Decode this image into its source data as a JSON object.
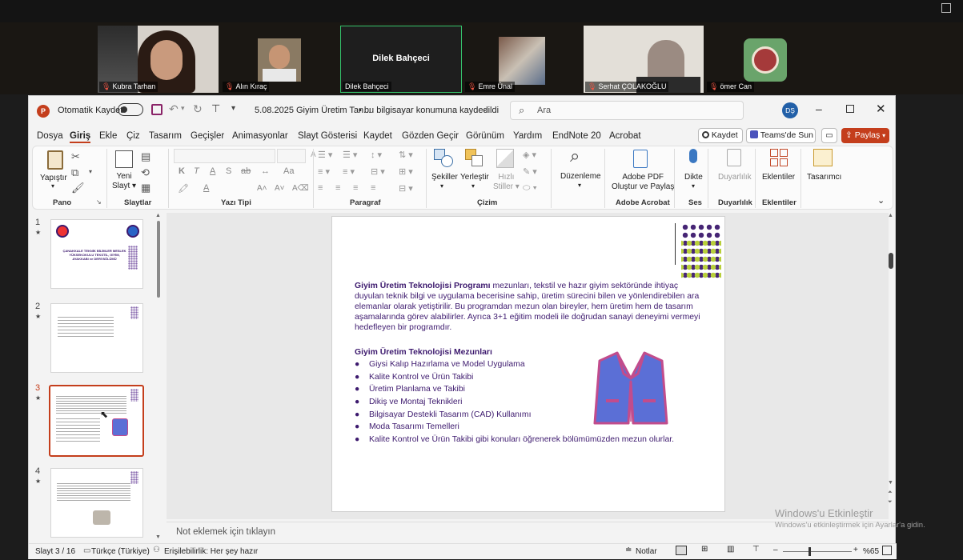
{
  "meeting": {
    "participants": [
      {
        "name": "Kubra Tarhan"
      },
      {
        "name": "Alın Kıraç"
      },
      {
        "name": "Dilek Bahçeci",
        "tile_label": "Dilek Bahçeci"
      },
      {
        "name": "Emre Ünal"
      },
      {
        "name": "Serhat ÇOLAKOĞLU"
      },
      {
        "name": "ömer Can"
      }
    ]
  },
  "titlebar": {
    "autosave_label": "Otomatik Kaydet",
    "doc_title": "5.08.2025 Giyim Üretim Tan...",
    "save_state": "• bu bilgisayar konumuna kaydedildi",
    "search_placeholder": "Ara",
    "avatar_initials": "DŞ"
  },
  "menu": [
    "Dosya",
    "Giriş",
    "Ekle",
    "Çiz",
    "Tasarım",
    "Geçişler",
    "Animasyonlar",
    "Slayt Gösterisi",
    "Kaydet",
    "Gözden Geçir",
    "Görünüm",
    "Yardım",
    "EndNote 20",
    "Acrobat"
  ],
  "menu_right": {
    "record": "Kaydet",
    "teams": "Teams'de Sun",
    "share": "Paylaş"
  },
  "ribbon": {
    "paste": "Yapıştır",
    "new_slide": [
      "Yeni",
      "Slayt"
    ],
    "shapes": "Şekiller",
    "arrange": "Yerleştir",
    "quick_styles": [
      "Hızlı",
      "Stiller"
    ],
    "editing": "Düzenleme",
    "adobe": [
      "Adobe PDF",
      "Oluştur ve Paylaş"
    ],
    "dictate": "Dikte",
    "sensitivity": "Duyarlılık",
    "addins": "Eklentiler",
    "designer": "Tasarımcı",
    "groups": {
      "clipboard": "Pano",
      "slides": "Slaytlar",
      "font": "Yazı Tipi",
      "paragraph": "Paragraf",
      "drawing": "Çizim",
      "adobe": "Adobe Acrobat",
      "voice": "Ses",
      "sensitivity": "Duyarlılık",
      "addins": "Eklentiler"
    },
    "font_buttons": [
      "K",
      "T",
      "A",
      "S",
      "ab"
    ]
  },
  "thumbnails": [
    {
      "num": "1",
      "text": "ÇANAKKALE TEKNİK BİLİMLER MESLEK YÜKSEKOKULU TEKSTİL, GİYİM, AYAKKABI ve DERİ BÖLÜMÜ"
    },
    {
      "num": "2"
    },
    {
      "num": "3"
    },
    {
      "num": "4"
    }
  ],
  "slide": {
    "para_bold": "Giyim Üretim Teknolojisi Programı",
    "para_rest": " mezunları, tekstil ve hazır giyim sektöründe ihtiyaç duyulan teknik bilgi ve uygulama becerisine sahip, üretim sürecini bilen ve yönlendirebilen ara elemanlar olarak yetiştirilir. Bu programdan mezun olan bireyler, hem üretim hem de tasarım aşamalarında görev alabilirler. Ayrıca 3+1 eğitim modeli ile doğrudan sanayi deneyimi vermeyi hedefleyen bir programdır.",
    "heading": "Giyim Üretim Teknolojisi Mezunları",
    "bullets": [
      "Giysi Kalıp Hazırlama ve Model Uygulama",
      "Kalite Kontrol ve Ürün Takibi",
      "Üretim Planlama ve Takibi",
      "Dikiş ve Montaj Teknikleri",
      "Bilgisayar Destekli Tasarım (CAD) Kullanımı",
      "Moda Tasarımı Temelleri",
      "Kalite Kontrol ve Ürün Takibi gibi konuları öğrenerek bölümümüzden mezun olurlar."
    ]
  },
  "notes_placeholder": "Not eklemek için tıklayın",
  "status": {
    "slide_pos": "Slayt 3 / 16",
    "language": "Türkçe (Türkiye)",
    "accessibility": "Erişilebilirlik: Her şey hazır",
    "notes": "Notlar",
    "zoom": "%65"
  },
  "watermark": {
    "title": "Windows'u Etkinleştir",
    "sub": "Windows'u etkinleştirmek için Ayarlar'a gidin."
  },
  "colors": {
    "accent": "#c43e1c",
    "purple": "#3d1a6e",
    "jacket": "#5b6fd6",
    "jacket_edge": "#c24c8c"
  }
}
